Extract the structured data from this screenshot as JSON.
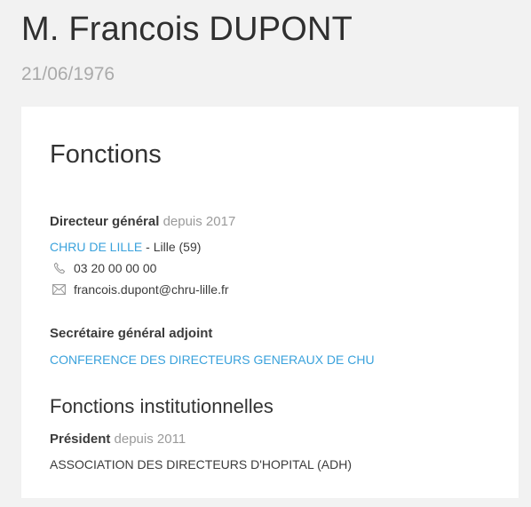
{
  "person": {
    "name": "M. Francois DUPONT",
    "birthdate": "21/06/1976"
  },
  "functions_section": {
    "title": "Fonctions",
    "items": [
      {
        "role": "Directeur général",
        "since": "depuis 2017",
        "organization": "CHRU DE LILLE",
        "location": "- Lille (59)",
        "phone": "03 20 00 00 00",
        "email": "francois.dupont@chru-lille.fr"
      },
      {
        "role": "Secrétaire général adjoint",
        "organization": "CONFERENCE DES DIRECTEURS GENERAUX DE CHU"
      }
    ]
  },
  "institutional_section": {
    "title": "Fonctions institutionnelles",
    "items": [
      {
        "role": "Président",
        "since": "depuis 2011",
        "organization": "ASSOCIATION DES DIRECTEURS D'HOPITAL (ADH)"
      }
    ]
  },
  "colors": {
    "background": "#f2f2f2",
    "card": "#ffffff",
    "link": "#3aa2dc",
    "muted": "#9a9a9a",
    "text": "#3b3b3b"
  },
  "icons": {
    "phone": "phone-icon",
    "email": "envelope-icon"
  }
}
